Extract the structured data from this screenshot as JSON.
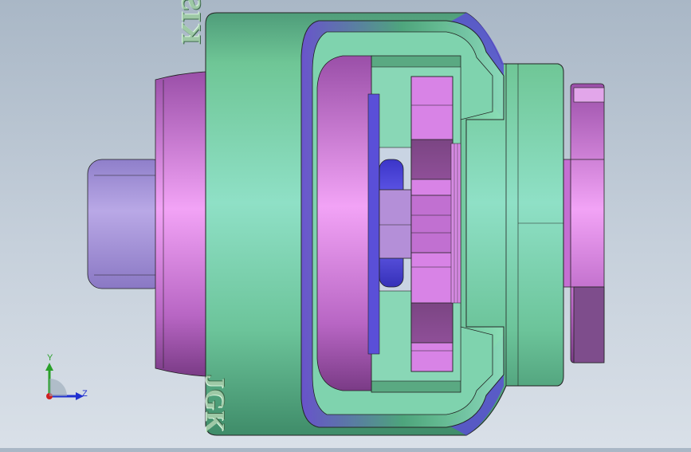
{
  "model": {
    "brand_text": "KISTER®",
    "part_code": "JGK"
  },
  "triad": {
    "y_label": "Y",
    "z_label": "Z"
  },
  "colors": {
    "body_green": "#7fd2a5",
    "part_magenta": "#c86fd6",
    "part_lavender": "#a898d8",
    "part_blue": "#5a55e0",
    "edge": "#1e1e1e"
  }
}
